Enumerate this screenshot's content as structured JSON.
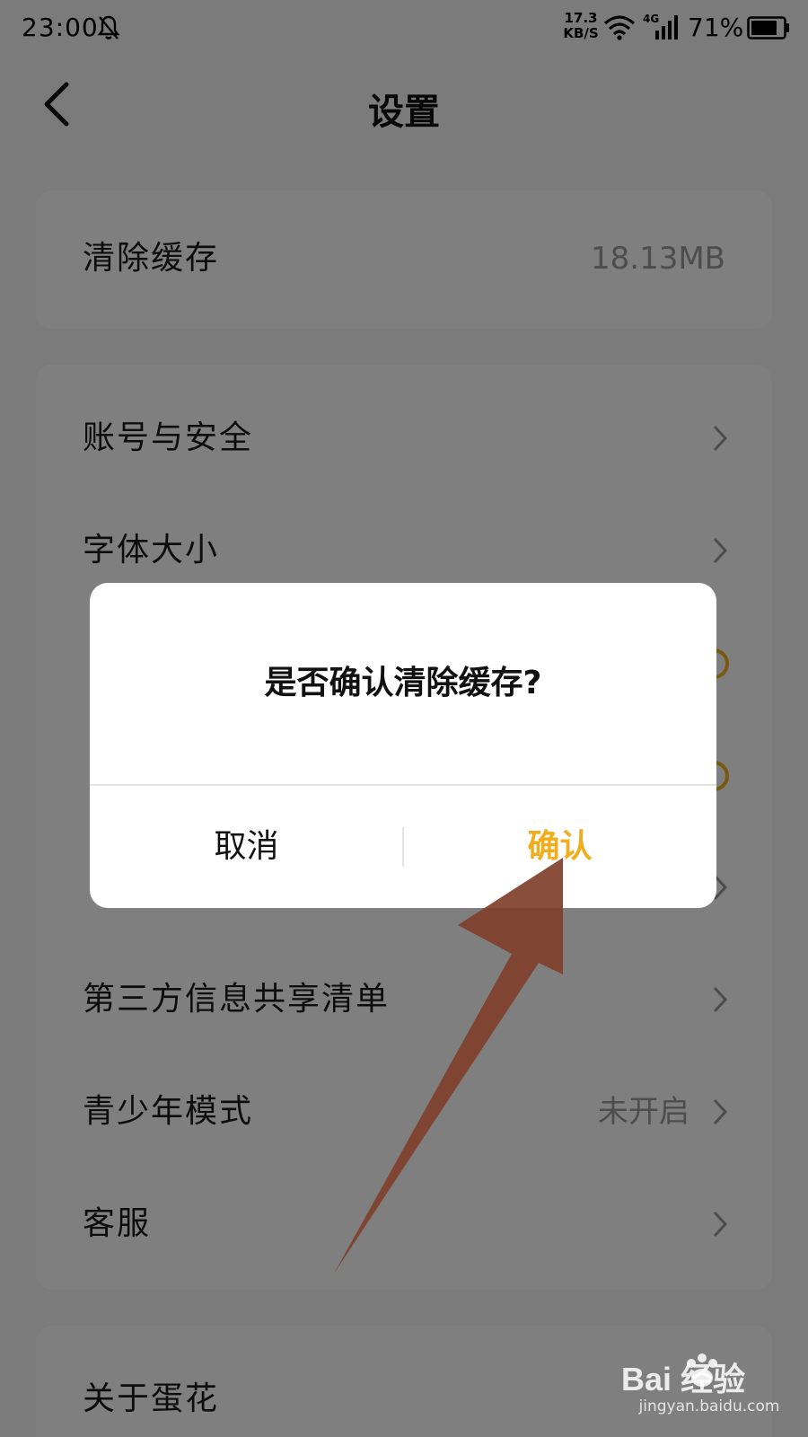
{
  "status_bar": {
    "time": "23:00",
    "net_speed_value": "17.3",
    "net_speed_unit": "KB/S",
    "network_type": "4G",
    "battery": "71%"
  },
  "header": {
    "title": "设置"
  },
  "settings": {
    "cache_row": {
      "label": "清除缓存",
      "value": "18.13MB"
    },
    "items": [
      {
        "label": "账号与安全"
      },
      {
        "label": "字体大小"
      },
      {
        "label": ""
      },
      {
        "label": ""
      },
      {
        "label": ""
      },
      {
        "label": "第三方信息共享清单"
      },
      {
        "label": "青少年模式",
        "value": "未开启"
      },
      {
        "label": "客服"
      }
    ],
    "about_row": {
      "label": "关于蛋花"
    }
  },
  "dialog": {
    "message": "是否确认清除缓存?",
    "cancel_label": "取消",
    "confirm_label": "确认"
  },
  "watermark": {
    "brand": "Bai 经验",
    "url": "jingyan.baidu.com"
  },
  "colors": {
    "accent": "#f2ad1c",
    "arrow": "#7f3f2b",
    "overlay": "rgba(0,0,0,0.5)"
  }
}
